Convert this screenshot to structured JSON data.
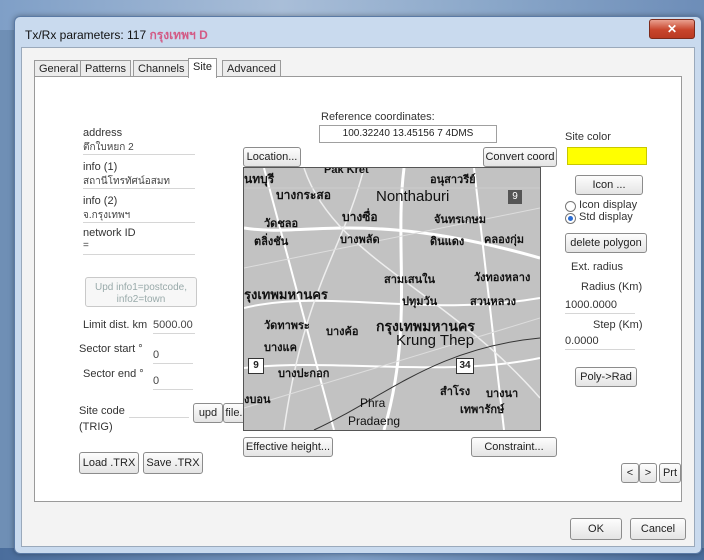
{
  "window": {
    "title_prefix": "Tx/Rx parameters: 117 ",
    "title_name": "กรุงเทพฯ D",
    "close_label": "✕"
  },
  "tabs": [
    {
      "label": "General"
    },
    {
      "label": "Patterns"
    },
    {
      "label": "Channels"
    },
    {
      "label": "Site",
      "active": true
    },
    {
      "label": "Advanced"
    }
  ],
  "site": {
    "address_label": "address",
    "address_value": "ตึกใบหยก 2",
    "info1_label": "info (1)",
    "info1_value": "สถานีโทรทัศน์อสมท",
    "info2_label": "info (2)",
    "info2_value": "จ.กรุงเทพฯ",
    "network_id_label": "network ID",
    "network_id_value": "=",
    "upd_info_line1": "Upd info1=postcode,",
    "upd_info_line2": "info2=town",
    "limit_dist_label": "Limit dist. km",
    "limit_dist_value": "5000.00",
    "sector_start_label": "Sector start °",
    "sector_start_value": "0",
    "sector_end_label": "Sector end °",
    "sector_end_value": "0",
    "site_code_label": "Site code",
    "site_code_value": "(TRIG)",
    "upd_label": "upd",
    "file_label": "file...",
    "load_trx_label": "Load .TRX",
    "save_trx_label": "Save .TRX"
  },
  "reference": {
    "title": "Reference coordinates:",
    "location_label": "Location...",
    "coords": "100.32240 13.45156 7 4DMS",
    "convert_label": "Convert coord",
    "effective_height_label": "Effective height...",
    "constraint_label": "Constraint..."
  },
  "map_labels": {
    "nonthaburi": "Nonthaburi",
    "krung_thep": "Krung Thep",
    "krung_thep_thai": "กรุงเทพมหานคร",
    "bangkok_thai": "รุงเทพมหานคร",
    "phra": "Phra",
    "pradaeng": "Pradaeng",
    "pak_kret": "Pak Kret",
    "route_9": "9",
    "route_34": "34",
    "route_9_top": "9",
    "th_1": "นทบุรี",
    "th_2": "บางกระสอ",
    "th_3": "อนุสาวรีย์",
    "th_4": "บางซื่อ",
    "th_5": "จันทรเกษม",
    "th_6": "บางพลัด",
    "th_7": "ดินแดง",
    "th_8": "คลองกุ่ม",
    "th_9": "สามเสนใน",
    "th_10": "วังทองหลาง",
    "th_11": "ปทุมวัน",
    "th_12": "สวนหลวง",
    "th_13": "วัดทาพระ",
    "th_14": "บางค้อ",
    "th_15": "บางแค",
    "th_16": "บางปะกอก",
    "th_17": "สำโรง",
    "th_18": "บางนา",
    "th_19": "เทพารักษ์",
    "th_20": "ตลิ่งชัน",
    "th_21": "วัดชลอ",
    "th_22": "งบอน"
  },
  "right": {
    "site_color_label": "Site color",
    "site_color": "#ffff00",
    "icon_label": "Icon ...",
    "icon_display_label": "Icon display",
    "std_display_label": "Std display",
    "delete_polygon_label": "delete polygon",
    "ext_radius_label": "Ext. radius",
    "radius_label": "Radius (Km)",
    "radius_value": "1000.0000",
    "step_label": "Step (Km)",
    "step_value": "0.0000",
    "poly_rad_label": "Poly->Rad",
    "prev_label": "<",
    "next_label": ">",
    "prt_label": "Prt"
  },
  "dialog": {
    "ok_label": "OK",
    "cancel_label": "Cancel"
  }
}
